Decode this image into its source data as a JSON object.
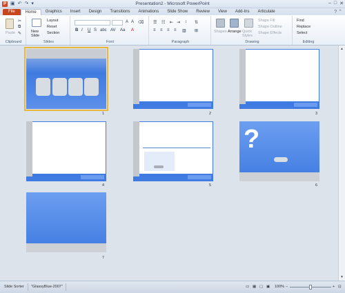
{
  "window": {
    "title": "Presentation2 - Microsoft PowerPoint"
  },
  "tabs": [
    {
      "label": "File"
    },
    {
      "label": "Home"
    },
    {
      "label": "Graphics"
    },
    {
      "label": "Insert"
    },
    {
      "label": "Design"
    },
    {
      "label": "Transitions"
    },
    {
      "label": "Animations"
    },
    {
      "label": "Slide Show"
    },
    {
      "label": "Review"
    },
    {
      "label": "View"
    },
    {
      "label": "Add-Ins"
    },
    {
      "label": "Articulate"
    }
  ],
  "ribbon": {
    "clipboard": {
      "group": "Clipboard",
      "paste": "Paste"
    },
    "slides": {
      "group": "Slides",
      "new_slide": "New Slide",
      "layout": "Layout",
      "reset": "Reset",
      "section": "Section"
    },
    "font": {
      "group": "Font"
    },
    "paragraph": {
      "group": "Paragraph"
    },
    "drawing": {
      "group": "Drawing",
      "shapes": "Shapes",
      "arrange": "Arrange",
      "quick_styles": "Quick Styles",
      "shape_fill": "Shape Fill",
      "shape_outline": "Shape Outline",
      "shape_effects": "Shape Effects"
    },
    "editing": {
      "group": "Editing",
      "find": "Find",
      "replace": "Replace",
      "select": "Select"
    }
  },
  "slides": [
    {
      "number": "1",
      "layout": "blue-cards",
      "selected": true
    },
    {
      "number": "2",
      "layout": "white-page"
    },
    {
      "number": "3",
      "layout": "white-page"
    },
    {
      "number": "4",
      "layout": "white-page"
    },
    {
      "number": "5",
      "layout": "white-page-form"
    },
    {
      "number": "6",
      "layout": "question"
    },
    {
      "number": "7",
      "layout": "blank-blue"
    }
  ],
  "status": {
    "view": "Slide Sorter",
    "theme": "\"GlassyBlue-2007\"",
    "zoom": "100%"
  },
  "colors": {
    "accent_blue": "#3f7be0",
    "file_tab": "#c8451d",
    "selection": "#e8b83c"
  }
}
